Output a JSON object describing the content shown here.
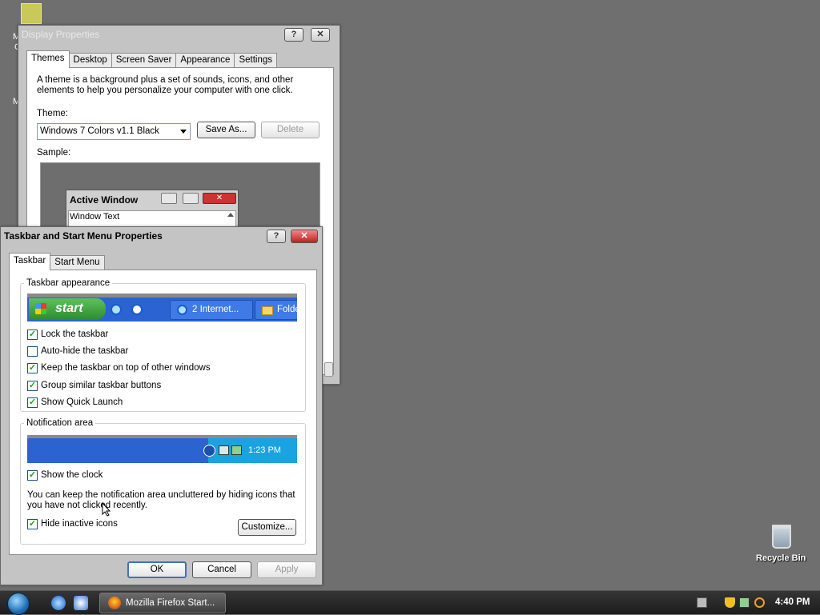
{
  "desktop": {
    "icon_fragment_1": "M",
    "icon_fragment_2": "C",
    "icon_fragment_3": "M",
    "recycle_bin_label": "Recycle Bin"
  },
  "display_properties": {
    "title": "Display Properties",
    "help_glyph": "?",
    "close_glyph": "✕",
    "tabs": [
      "Themes",
      "Desktop",
      "Screen Saver",
      "Appearance",
      "Settings"
    ],
    "description": "A theme is a background plus a set of sounds, icons, and other elements to help you personalize your computer with one click.",
    "theme_label": "Theme:",
    "theme_value": "Windows 7 Colors v1.1 Black",
    "save_as_label": "Save As...",
    "delete_label": "Delete",
    "sample_label": "Sample:",
    "sample_window_title": "Active Window",
    "sample_window_text": "Window Text"
  },
  "taskbar_properties": {
    "title": "Taskbar and Start Menu Properties",
    "help_glyph": "?",
    "close_glyph": "✕",
    "tabs": [
      "Taskbar",
      "Start Menu"
    ],
    "appearance_legend": "Taskbar appearance",
    "preview": {
      "start_label": "start",
      "task_label": "2 Internet...",
      "folder_label": "Folde"
    },
    "options": [
      {
        "label": "Lock the taskbar",
        "checked": true
      },
      {
        "label": "Auto-hide the taskbar",
        "checked": false
      },
      {
        "label": "Keep the taskbar on top of other windows",
        "checked": true
      },
      {
        "label": "Group similar taskbar buttons",
        "checked": true
      },
      {
        "label": "Show Quick Launch",
        "checked": true
      }
    ],
    "notification_legend": "Notification area",
    "notification_time": "1:23 PM",
    "show_clock_label": "Show the clock",
    "notification_description": "You can keep the notification area uncluttered by hiding icons that you have not clicked recently.",
    "hide_inactive_label": "Hide inactive icons",
    "customize_label": "Customize...",
    "ok_label": "OK",
    "cancel_label": "Cancel",
    "apply_label": "Apply",
    "check_glyph": "✓"
  },
  "taskbar": {
    "task_label": "Mozilla Firefox Start...",
    "time": "4:40 PM"
  }
}
